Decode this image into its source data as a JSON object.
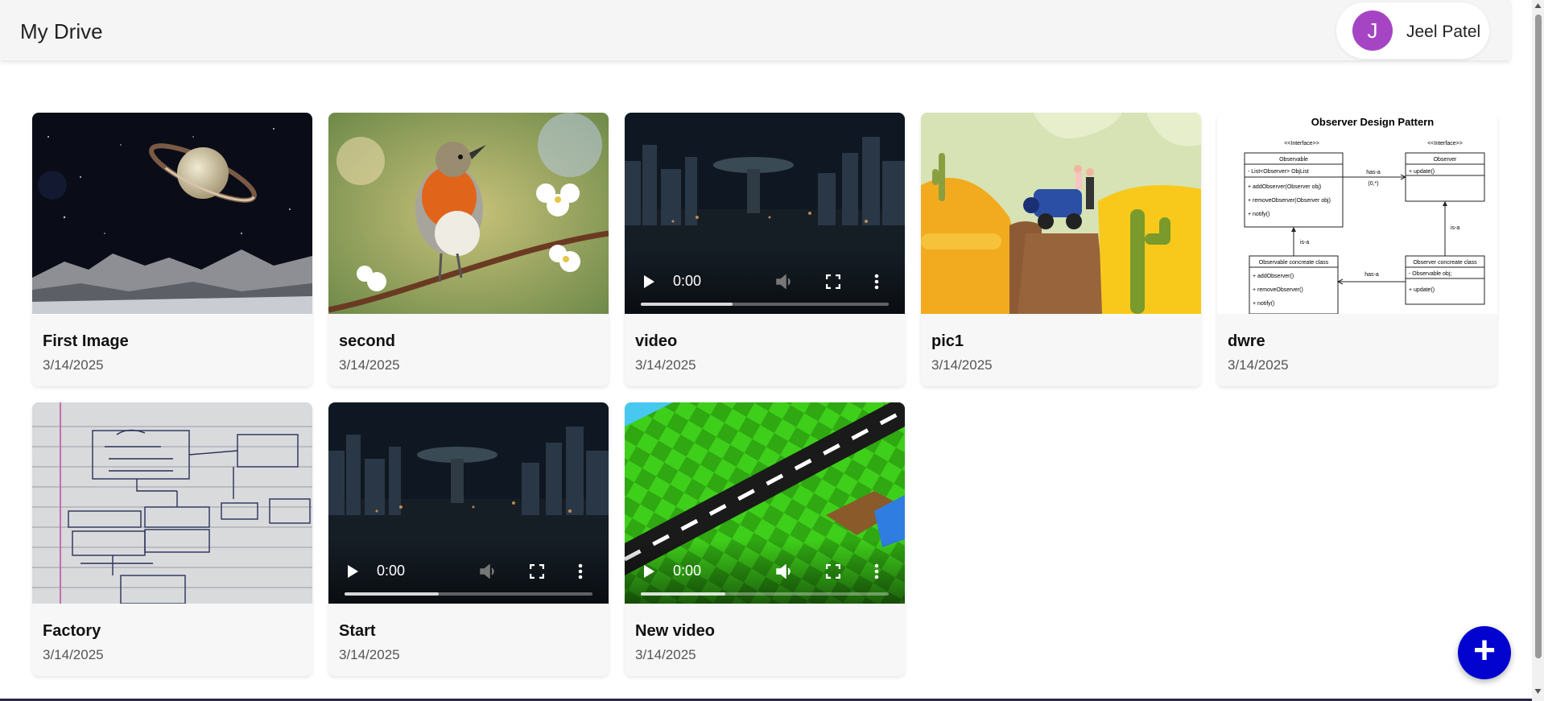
{
  "header": {
    "title": "My Drive",
    "user": {
      "initial": "J",
      "name": "Jeel Patel",
      "avatar_color": "#a545c4"
    }
  },
  "cards": [
    {
      "title": "First Image",
      "date": "3/14/2025",
      "kind": "image",
      "thumb": "saturn-image"
    },
    {
      "title": "second",
      "date": "3/14/2025",
      "kind": "image",
      "thumb": "robin-bird-image"
    },
    {
      "title": "video",
      "date": "3/14/2025",
      "kind": "video",
      "thumb": "city-ufo-video",
      "time": "0:00",
      "progress": 0.37
    },
    {
      "title": "pic1",
      "date": "3/14/2025",
      "kind": "image",
      "thumb": "desert-jeep-image"
    },
    {
      "title": "dwre",
      "date": "3/14/2025",
      "kind": "image",
      "thumb": "observer-diagram-image",
      "diagram": {
        "title": "Observer Design Pattern",
        "interface_tag": "<<Interface>>",
        "observable": "Observable",
        "observable_field": "- List<Observer> ObjList",
        "observable_methods": [
          "+ addObserver(Observer obj)",
          "+ removeObserver(Observer obj)",
          "+ notify()"
        ],
        "observer": "Observer",
        "observer_methods": [
          "+ update()"
        ],
        "has_a": "has-a",
        "multiplicity": "(0,*)",
        "is_a": "is-a",
        "observable_concrete": "Observable concreate class",
        "observable_concrete_methods": [
          "+ addObserver()",
          "+ removeObserver()",
          "+ notify()"
        ],
        "observer_concrete": "Observer concreate class",
        "observer_concrete_field": "- Observable obj;",
        "observer_concrete_methods": [
          "+ update()"
        ]
      }
    },
    {
      "title": "Factory",
      "date": "3/14/2025",
      "kind": "image",
      "thumb": "factory-sketch-image"
    },
    {
      "title": "Start",
      "date": "3/14/2025",
      "kind": "video",
      "thumb": "city-ufo-video",
      "time": "0:00",
      "progress": 0.38
    },
    {
      "title": "New video",
      "date": "3/14/2025",
      "kind": "video",
      "thumb": "isometric-road-video",
      "time": "0:00",
      "progress": 0.34
    }
  ],
  "fab": {
    "label": "+",
    "color": "#0303cf"
  }
}
